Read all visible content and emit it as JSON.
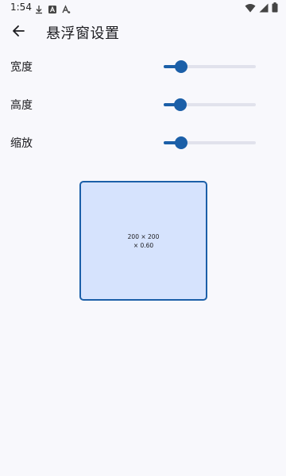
{
  "status_bar": {
    "time": "1:54",
    "left_icons": [
      "download-icon",
      "font-a-icon",
      "font-a-alt-icon"
    ],
    "right_icons": [
      "wifi-icon",
      "signal-icon",
      "battery-icon"
    ]
  },
  "app_bar": {
    "back_icon": "arrow-back-icon",
    "title": "悬浮窗设置"
  },
  "settings": {
    "width": {
      "label": "宽度",
      "value": 0.19
    },
    "height": {
      "label": "高度",
      "value": 0.18
    },
    "scale": {
      "label": "缩放",
      "value": 0.19
    }
  },
  "preview": {
    "line1": "200 × 200",
    "line2": "× 0.60"
  },
  "colors": {
    "accent": "#1b5fa8",
    "track": "#e1e2ec",
    "preview_bg": "#d6e3fd",
    "background": "#f8f8fc"
  }
}
